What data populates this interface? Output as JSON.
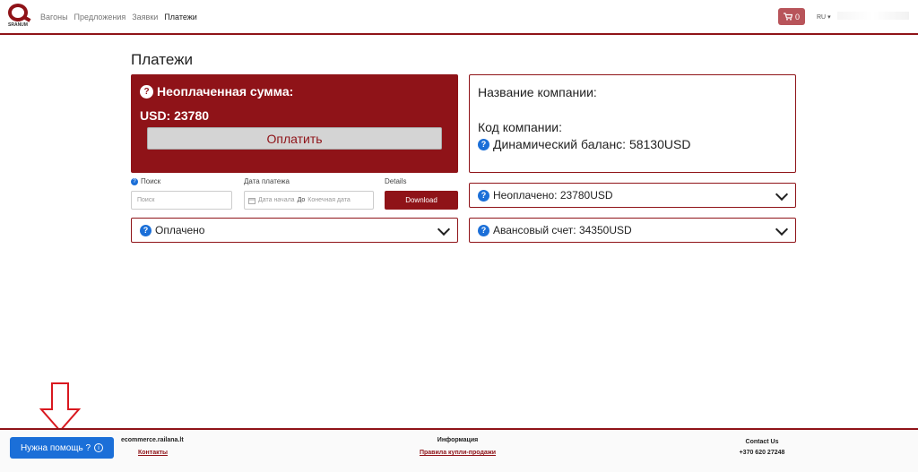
{
  "nav": {
    "logo_text": "SRANUM",
    "links": [
      "Вагоны",
      "Предложения",
      "Заявки",
      "Платежи"
    ],
    "cart_count": "0",
    "lang": "RU"
  },
  "page": {
    "title": "Платежи"
  },
  "unpaid_card": {
    "heading": "Неоплаченная сумма:",
    "amount": "USD: 23780",
    "pay_label": "Оплатить"
  },
  "filters": {
    "search_label": "Поиск",
    "search_placeholder": "Поиск",
    "date_label": "Дата платежа",
    "date_from": "Дата начала",
    "date_sep": "До",
    "date_to": "Конечная дата",
    "details_label": "Details",
    "download_label": "Download"
  },
  "paid_accordion": {
    "label": "Оплачено"
  },
  "company": {
    "name_label": "Название компании:",
    "code_label": "Код компании:",
    "balance_label": "Динамический баланс: 58130USD"
  },
  "unpaid_accordion": {
    "label": "Неоплачено: 23780USD"
  },
  "advance_accordion": {
    "label": "Авансовый счет: 34350USD"
  },
  "footer": {
    "help_label": "Нужна помощь ?",
    "site": "ecommerce.railana.lt",
    "contacts_link": "Контакты",
    "info_title": "Информация",
    "rules_link": "Правила купли-продажи",
    "contact_title": "Contact Us",
    "phone": "+370 620 27248"
  },
  "colors": {
    "brand": "#8f1318",
    "accent": "#1b6fd8"
  }
}
